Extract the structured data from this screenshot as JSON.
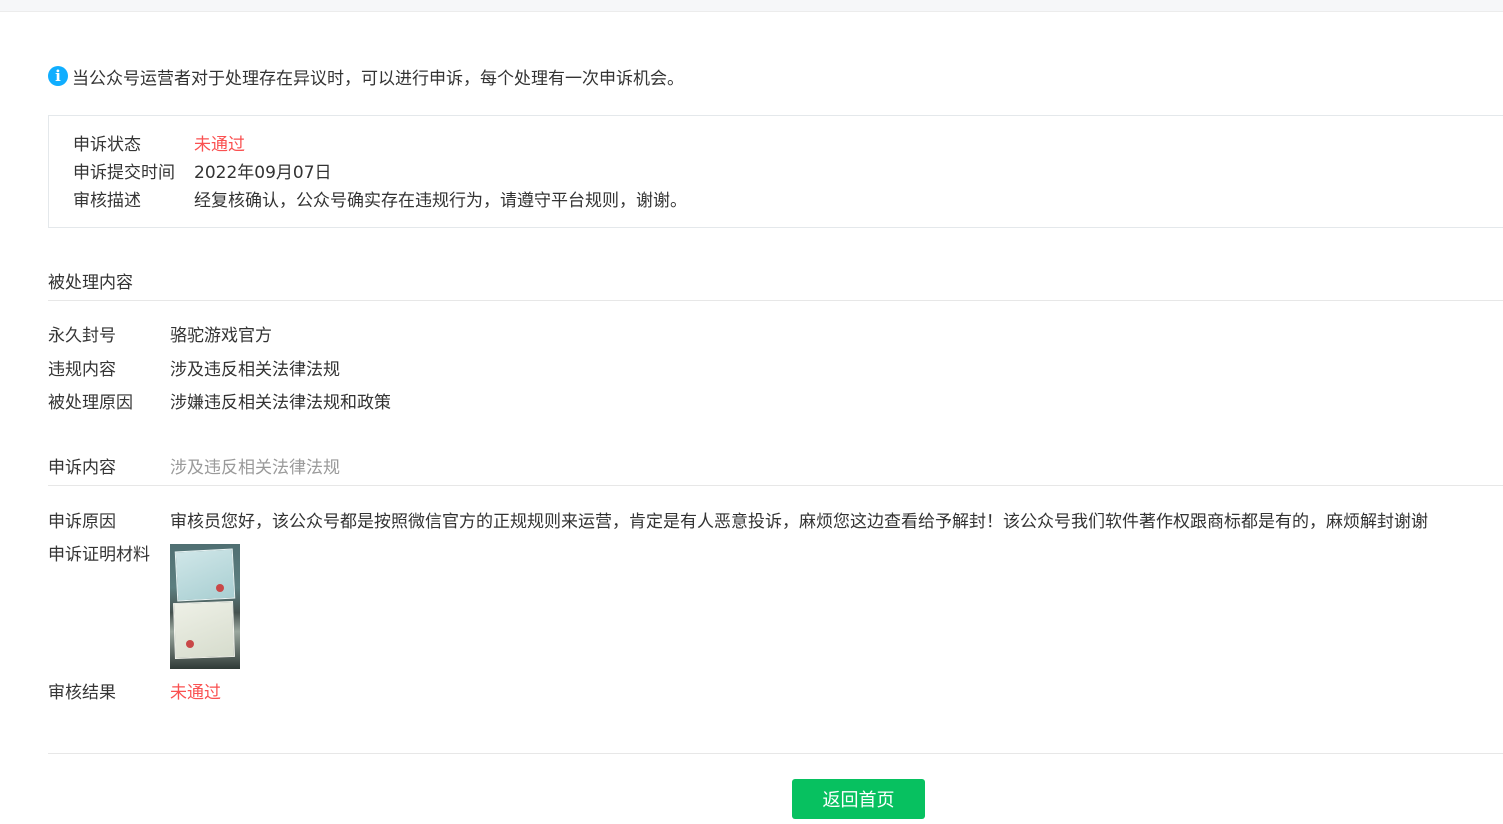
{
  "notice": {
    "icon": "info-icon",
    "text": "当公众号运营者对于处理存在异议时，可以进行申诉，每个处理有一次申诉机会。"
  },
  "status": {
    "rows": [
      {
        "label": "申诉状态",
        "value": "未通过"
      },
      {
        "label": "申诉提交时间",
        "value": "2022年09月07日"
      },
      {
        "label": "审核描述",
        "value": "经复核确认，公众号确实存在违规行为，请遵守平台规则，谢谢。"
      }
    ]
  },
  "processed": {
    "title": "被处理内容",
    "rows": [
      {
        "label": "永久封号",
        "value": "骆驼游戏官方"
      },
      {
        "label": "违规内容",
        "value": "涉及违反相关法律法规"
      },
      {
        "label": "被处理原因",
        "value": "涉嫌违反相关法律法规和政策"
      }
    ]
  },
  "appeal": {
    "content_label": "申诉内容",
    "content_value": "涉及违反相关法律法规",
    "reason_label": "申诉原因",
    "reason_value": "审核员您好，该公众号都是按照微信官方的正规规则来运营，肯定是有人恶意投诉，麻烦您这边查看给予解封！该公众号我们软件著作权跟商标都是有的，麻烦解封谢谢",
    "evidence_label": "申诉证明材料",
    "result_label": "审核结果",
    "result_value": "未通过"
  },
  "actions": {
    "back_label": "返回首页"
  },
  "colors": {
    "accent": "#07c160",
    "error": "#fa5151",
    "info": "#10aeff"
  }
}
